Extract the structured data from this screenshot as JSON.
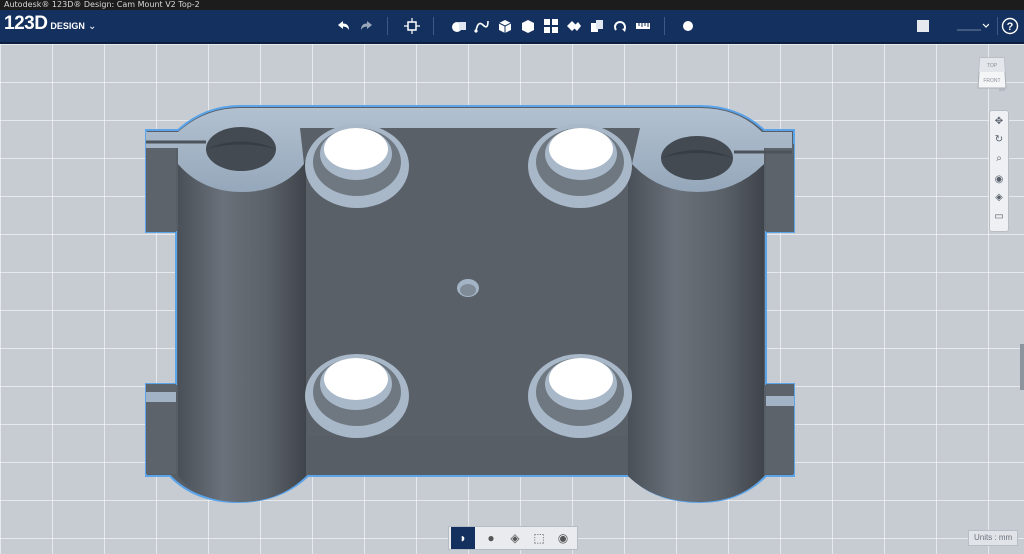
{
  "window": {
    "title": "Autodesk® 123D® Design: Cam Mount V2 Top-2"
  },
  "logo": {
    "main": "123D",
    "sub": "DESIGN",
    "menu_glyph": "⌄"
  },
  "toolbar": {
    "left_icons": [
      "undo-icon",
      "redo-icon",
      "transform-icon"
    ],
    "center_icons": [
      "primitives-icon",
      "sketch-icon",
      "construct-icon",
      "modify-icon",
      "pattern-icon",
      "grouping-icon",
      "combine-icon",
      "snap-icon",
      "measure-icon",
      "material-icon"
    ],
    "right_icons": [
      "panel-icon",
      "sign-in-icon",
      "help-icon"
    ],
    "help_label": "?"
  },
  "viewcube": {
    "top_label": "TOP",
    "front_label": "FRONT"
  },
  "nav_panel": {
    "icons": [
      "pan-icon",
      "orbit-icon",
      "zoom-icon",
      "fit-icon",
      "view-icon",
      "visibility-icon"
    ]
  },
  "bottom_toolbar": {
    "icons": [
      "solid-view-icon",
      "material-view-icon",
      "outline-view-icon",
      "component-view-icon",
      "visibility-toggle-icon"
    ]
  },
  "units": {
    "label": "Units : mm"
  },
  "colors": {
    "app_bar": "#14305e",
    "model_body": "#585e66",
    "model_top": "#a2b3c5",
    "selection_outline": "#5ba4ea"
  }
}
